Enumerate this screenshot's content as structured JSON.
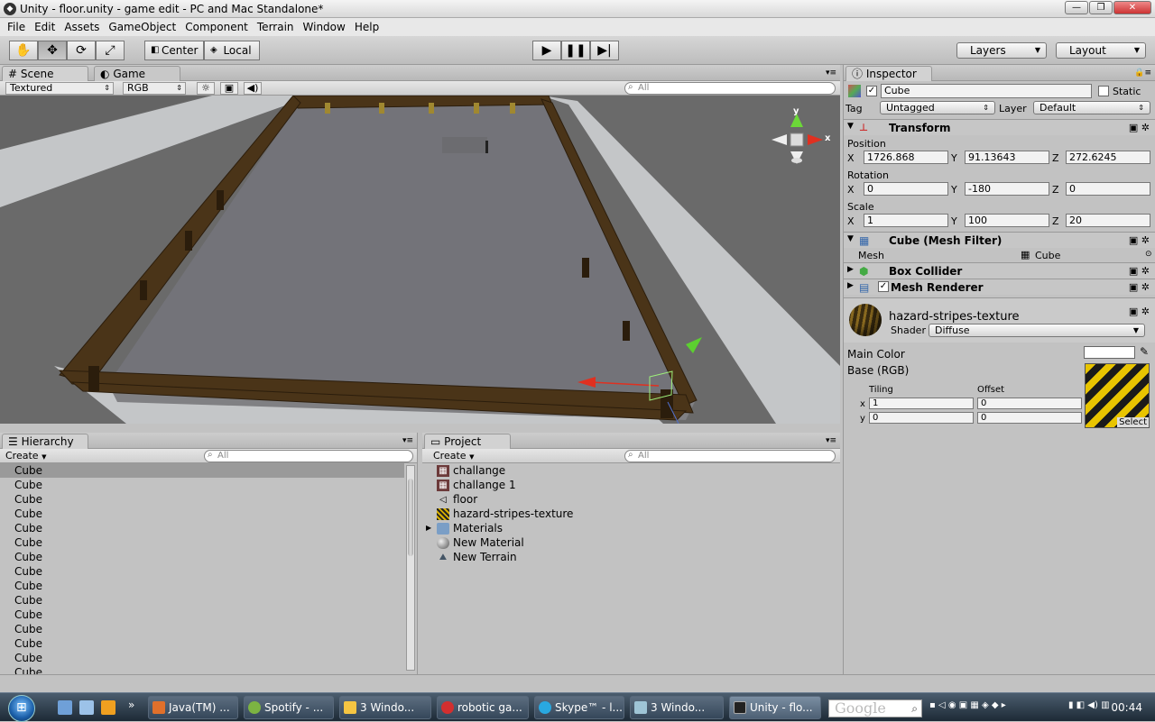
{
  "window": {
    "title": "Unity - floor.unity - game edit - PC and Mac Standalone*"
  },
  "menu": [
    "File",
    "Edit",
    "Assets",
    "GameObject",
    "Component",
    "Terrain",
    "Window",
    "Help"
  ],
  "toolbar": {
    "pivot": "Center",
    "space": "Local",
    "layers": "Layers",
    "layout": "Layout"
  },
  "scene": {
    "tab_scene": "Scene",
    "tab_game": "Game",
    "render_mode": "Textured",
    "color_mode": "RGB",
    "search_placeholder": "All",
    "gizmo_y": "y",
    "gizmo_x": "x"
  },
  "hierarchy": {
    "tab": "Hierarchy",
    "create": "Create",
    "search_placeholder": "All",
    "items": [
      "Cube",
      "Cube",
      "Cube",
      "Cube",
      "Cube",
      "Cube",
      "Cube",
      "Cube",
      "Cube",
      "Cube",
      "Cube",
      "Cube",
      "Cube",
      "Cube",
      "Cube"
    ]
  },
  "project": {
    "tab": "Project",
    "create": "Create",
    "search_placeholder": "All",
    "items": [
      {
        "label": "challange",
        "icon": "scene-asset-icon"
      },
      {
        "label": "challange 1",
        "icon": "scene-asset-icon"
      },
      {
        "label": "floor",
        "icon": "unity-scene-icon"
      },
      {
        "label": "hazard-stripes-texture",
        "icon": "texture-icon"
      },
      {
        "label": "Materials",
        "icon": "folder-icon"
      },
      {
        "label": "New Material",
        "icon": "material-icon"
      },
      {
        "label": "New Terrain",
        "icon": "terrain-icon"
      }
    ]
  },
  "inspector": {
    "tab": "Inspector",
    "object_name": "Cube",
    "static_label": "Static",
    "tag_label": "Tag",
    "tag_value": "Untagged",
    "layer_label": "Layer",
    "layer_value": "Default",
    "transform": {
      "title": "Transform",
      "position_label": "Position",
      "position": {
        "x": "1726.868",
        "y": "91.13643",
        "z": "272.6245"
      },
      "rotation_label": "Rotation",
      "rotation": {
        "x": "0",
        "y": "-180",
        "z": "0"
      },
      "scale_label": "Scale",
      "scale": {
        "x": "1",
        "y": "100",
        "z": "20"
      }
    },
    "mesh_filter": {
      "title": "Cube (Mesh Filter)",
      "mesh_label": "Mesh",
      "mesh_value": "Cube"
    },
    "box_collider": {
      "title": "Box Collider"
    },
    "mesh_renderer": {
      "title": "Mesh Renderer"
    },
    "material": {
      "name": "hazard-stripes-texture",
      "shader_label": "Shader",
      "shader_value": "Diffuse",
      "main_color_label": "Main Color",
      "base_label": "Base (RGB)",
      "tiling_label": "Tiling",
      "offset_label": "Offset",
      "tiling": {
        "x": "1",
        "y": "0"
      },
      "offset": {
        "x": "0",
        "y": "0"
      },
      "select_label": "Select"
    },
    "axis": {
      "x": "X",
      "y": "Y",
      "z": "Z",
      "lx": "x",
      "ly": "y"
    }
  },
  "taskbar": {
    "items": [
      {
        "label": "Java(TM) ...",
        "color": "#e0702b"
      },
      {
        "label": "Spotify - ...",
        "color": "#7cb342"
      },
      {
        "label": "3 Windo...",
        "color": "#f5c542"
      },
      {
        "label": "robotic ga...",
        "color": "#d32f2f"
      },
      {
        "label": "Skype™ - l...",
        "color": "#29a8e0"
      },
      {
        "label": "3 Windo...",
        "color": "#9ec4d6"
      },
      {
        "label": "Unity - flo...",
        "color": "#222222"
      }
    ],
    "search_text": "Google",
    "clock": "00:44"
  }
}
